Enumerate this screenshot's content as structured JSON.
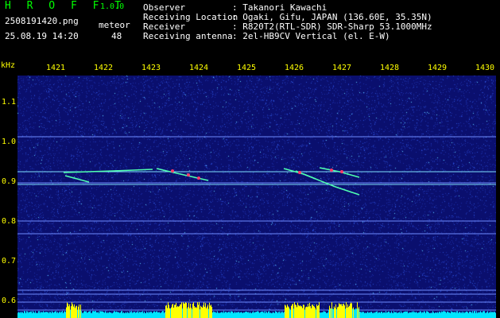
{
  "header": {
    "app_title": "H R O F F T",
    "version": "1.0.0",
    "filename": "2508191420.png",
    "datetime": "25.08.19 14:20",
    "meteor_label": "meteor",
    "meteor_count": "48",
    "fields": [
      {
        "label": "Observer",
        "value": ": Takanori Kawachi"
      },
      {
        "label": "Receiving Location",
        "value": ": Ogaki, Gifu, JAPAN (136.60E, 35.35N)"
      },
      {
        "label": "Receiver",
        "value": ": R820T2(RTL-SDR) SDR-Sharp 53.1000MHz"
      },
      {
        "label": "Receiving antenna",
        "value": ": 2el-HB9CV Vertical (el. E-W)"
      }
    ]
  },
  "axes": {
    "y_unit": "kHz",
    "x_ticks": [
      "1421",
      "1422",
      "1423",
      "1424",
      "1425",
      "1426",
      "1427",
      "1428",
      "1429",
      "1430"
    ],
    "y_ticks": [
      "1.1",
      "1.0",
      "0.9",
      "0.8",
      "0.7",
      "0.6"
    ]
  },
  "colors": {
    "background": "#000000",
    "plot_bg": "#0a0f6e",
    "axis_text": "#ffff00",
    "title_green": "#00ff00",
    "info_text": "#ffffff",
    "signal_bar": "#00e5ff",
    "signal_peak": "#ffff00"
  }
}
